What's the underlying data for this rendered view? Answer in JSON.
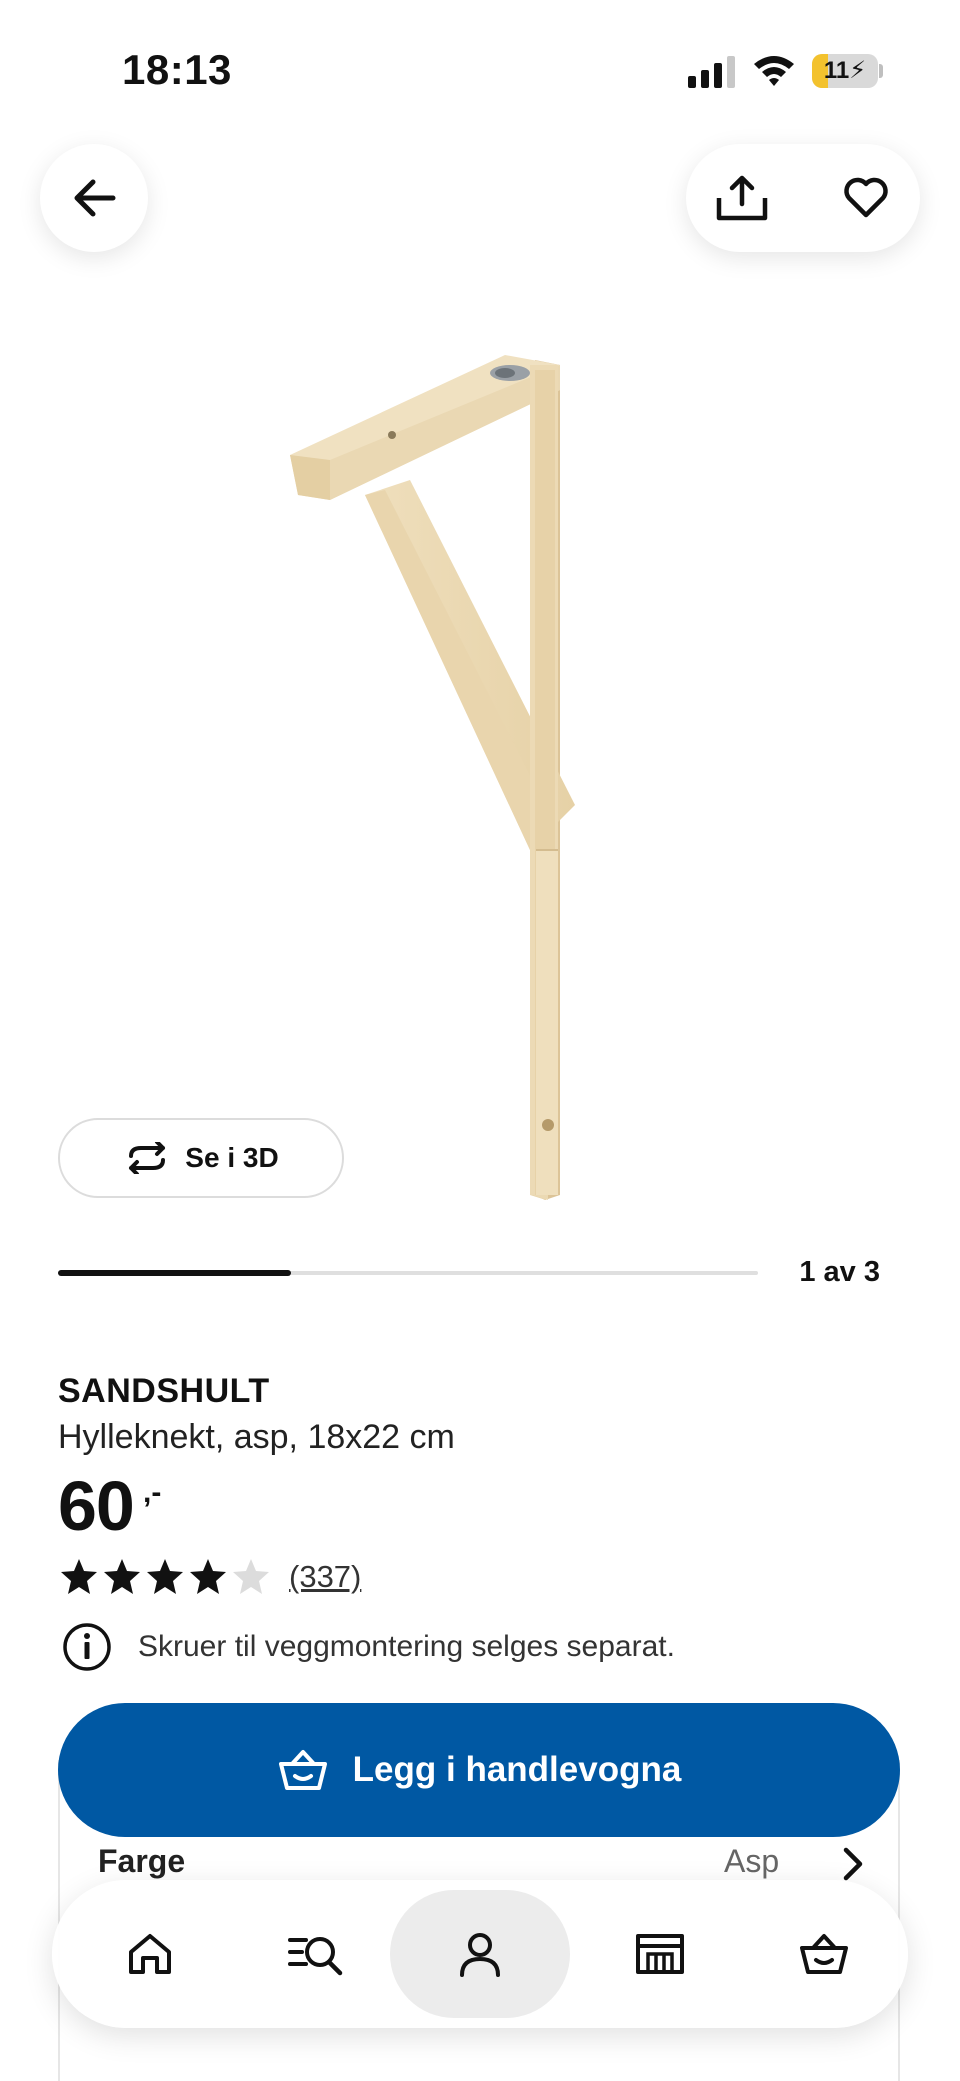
{
  "status_bar": {
    "time": "18:13",
    "battery_level": "11",
    "battery_charging": true,
    "battery_fraction": 0.11,
    "signal_bars": 3
  },
  "header": {
    "back_icon": "arrow-left-icon",
    "share_icon": "share-icon",
    "favorite_icon": "heart-outline-icon"
  },
  "gallery": {
    "view_3d_label": "Se i 3D",
    "counter": "1 av 3",
    "current_image": 1,
    "total_images": 3
  },
  "product": {
    "name": "SANDSHULT",
    "description": "Hylleknekt, asp, 18x22 cm",
    "price": "60",
    "price_suffix": ",-",
    "rating_stars": 4,
    "rating_max": 5,
    "rating_count": "(337)",
    "info_notice": "Skruer til veggmontering selges separat."
  },
  "purchase": {
    "add_to_cart_label": "Legg i handlevogna",
    "color_label": "Farge",
    "color_value": "Asp"
  },
  "bottom_nav": {
    "items": [
      {
        "icon": "home-icon"
      },
      {
        "icon": "search-list-icon"
      },
      {
        "icon": "profile-icon",
        "active": true
      },
      {
        "icon": "store-icon"
      },
      {
        "icon": "cart-icon"
      }
    ]
  },
  "colors": {
    "accent": "#0058a3",
    "battery": "#f3c22e",
    "text": "#111111"
  }
}
